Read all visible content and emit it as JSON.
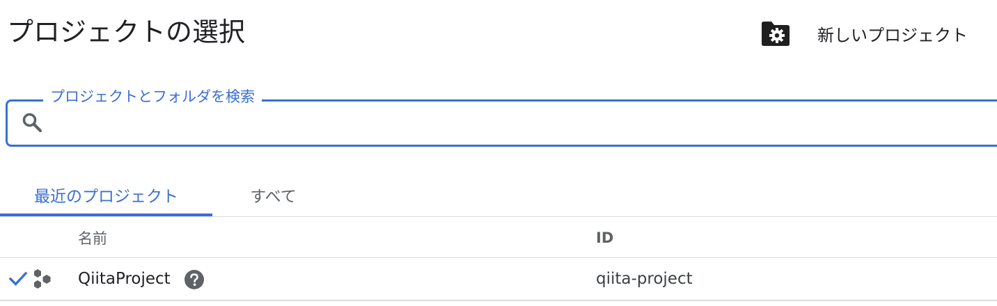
{
  "header": {
    "title": "プロジェクトの選択",
    "new_project_label": "新しいプロジェクト",
    "new_project_icon": "folder-gear-icon"
  },
  "search": {
    "label": "プロジェクトとフォルダを検索",
    "value": "",
    "icon": "search-icon"
  },
  "tabs": [
    {
      "label": "最近のプロジェクト",
      "active": true
    },
    {
      "label": "すべて",
      "active": false
    }
  ],
  "table": {
    "headers": {
      "name": "名前",
      "id": "ID"
    },
    "rows": [
      {
        "selected": true,
        "icon": "project-hexagons-icon",
        "name": "QiitaProject",
        "help_icon": "help-icon",
        "id": "qiita-project"
      }
    ]
  },
  "colors": {
    "accent": "#3a6fd1",
    "text_primary": "#202124",
    "text_secondary": "#5f6368",
    "divider": "#dadce0"
  }
}
